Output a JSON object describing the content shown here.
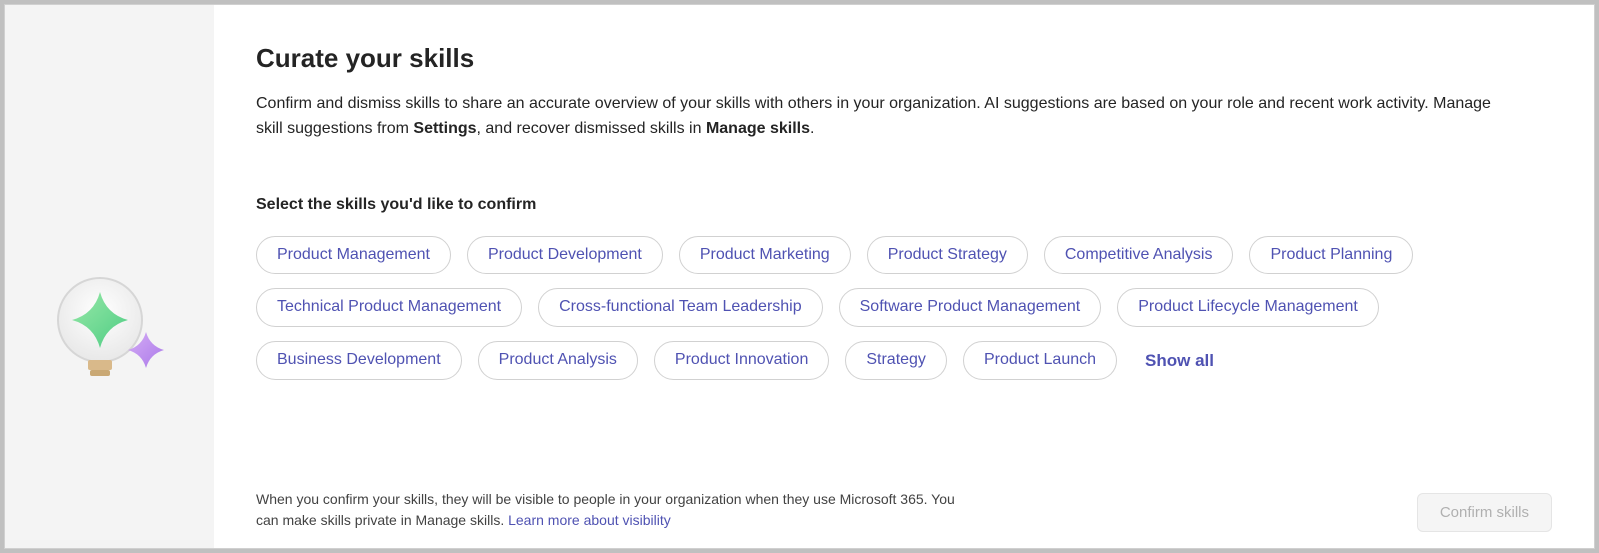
{
  "header": {
    "title": "Curate your skills",
    "description_pre": "Confirm and dismiss skills to share an accurate overview of your skills with others in your organization. AI suggestions are based on your role and recent work activity. Manage skill suggestions from ",
    "settings_word": "Settings",
    "description_mid": ", and recover dismissed skills in  ",
    "manage_word": "Manage skills",
    "description_post": "."
  },
  "select_label": "Select the skills you'd like to confirm",
  "skills": [
    "Product Management",
    "Product Development",
    "Product Marketing",
    "Product Strategy",
    "Competitive Analysis",
    "Product Planning",
    "Technical Product Management",
    "Cross-functional Team Leadership",
    "Software Product Management",
    "Product Lifecycle Management",
    "Business Development",
    "Product Analysis",
    "Product Innovation",
    "Strategy",
    "Product Launch"
  ],
  "show_all_label": "Show all",
  "footer": {
    "text_pre": "When you confirm your skills, they will be visible to people in your organization when they use Microsoft 365. You can make skills private in Manage skills. ",
    "link_label": "Learn more about visibility"
  },
  "confirm_button": "Confirm skills"
}
